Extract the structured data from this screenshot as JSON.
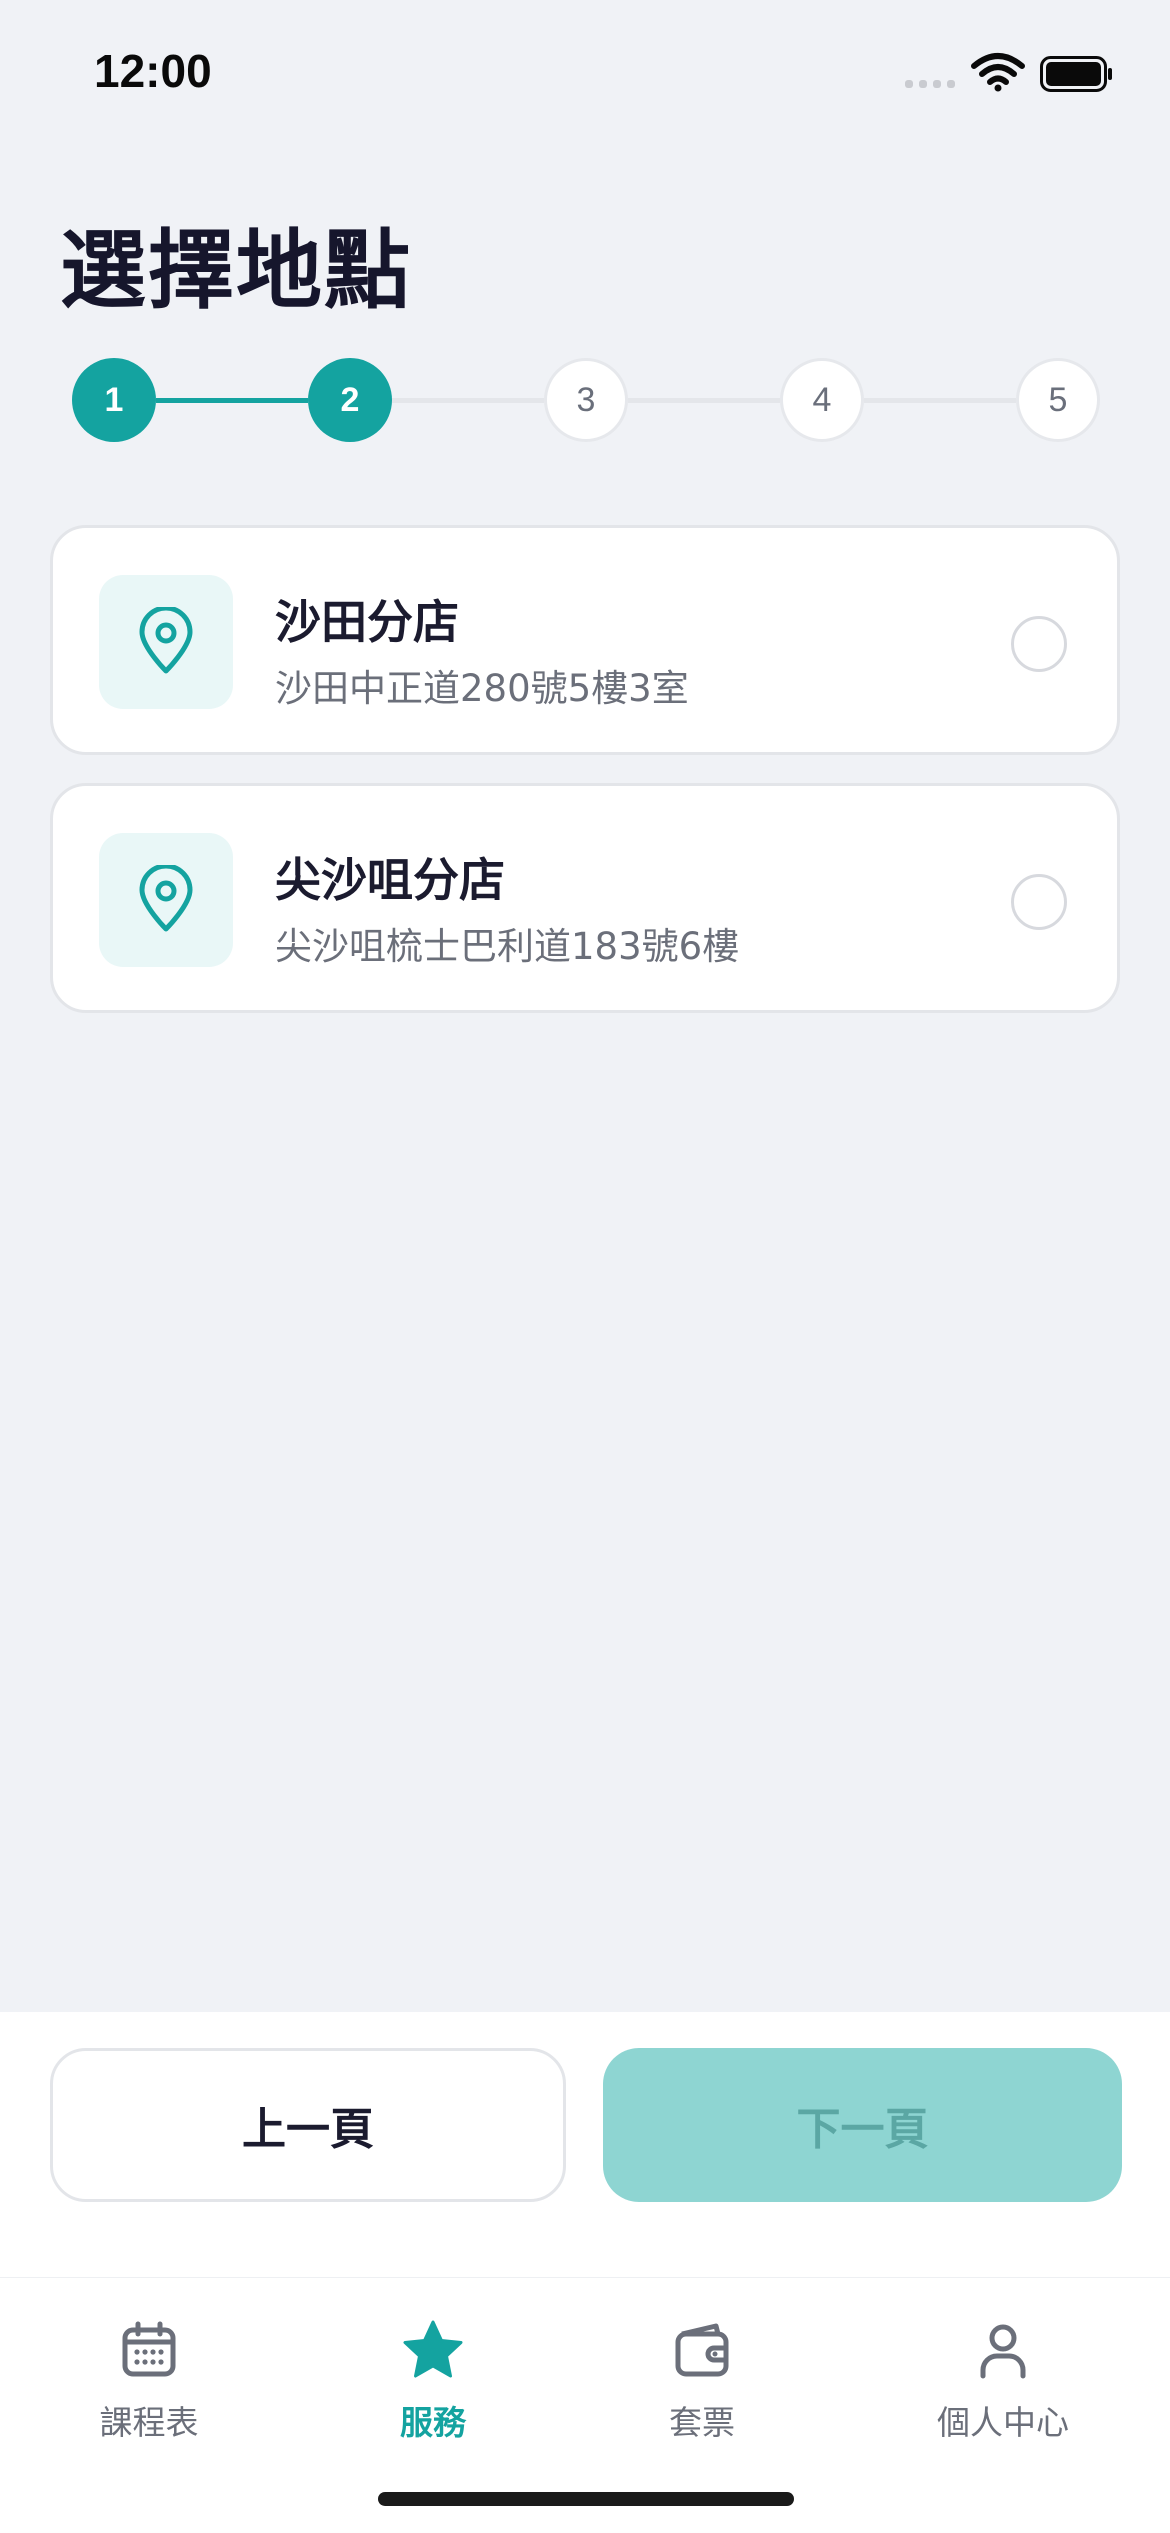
{
  "status_bar": {
    "time": "12:00"
  },
  "page_title": "選擇地點",
  "stepper": {
    "steps": [
      "1",
      "2",
      "3",
      "4",
      "5"
    ],
    "current_step": 2
  },
  "locations": [
    {
      "name": "沙田分店",
      "address": "沙田中正道280號5樓3室",
      "icon": "location-pin-icon",
      "selected": false
    },
    {
      "name": "尖沙咀分店",
      "address": "尖沙咀梳士巴利道183號6樓",
      "icon": "location-pin-icon",
      "selected": false
    }
  ],
  "actions": {
    "prev_label": "上一頁",
    "next_label": "下一頁"
  },
  "tab_bar": {
    "items": [
      {
        "label": "課程表",
        "icon": "calendar-icon",
        "active": false
      },
      {
        "label": "服務",
        "icon": "star-icon",
        "active": true
      },
      {
        "label": "套票",
        "icon": "wallet-icon",
        "active": false
      },
      {
        "label": "個人中心",
        "icon": "user-icon",
        "active": false
      }
    ]
  },
  "colors": {
    "accent": "#14A3A0",
    "accent_disabled": "#8ED5D2",
    "background": "#F0F2F6",
    "text_primary": "#1B1B2F",
    "text_secondary": "#6B6F7A"
  }
}
